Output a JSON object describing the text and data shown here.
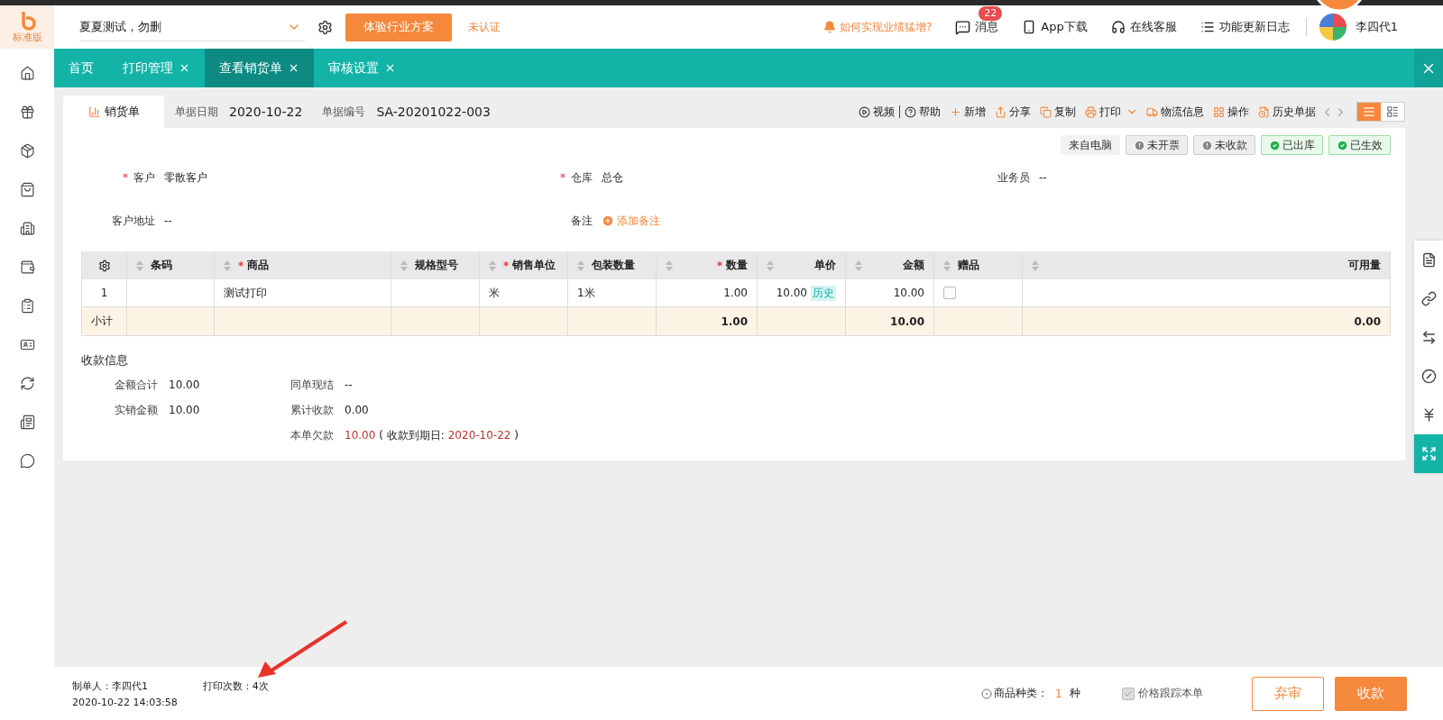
{
  "logo": {
    "label": "标准版"
  },
  "header": {
    "company": "夏夏测试，勿删",
    "trial_button": "体验行业方案",
    "certification": "未认证",
    "promo": "如何实现业绩猛增?",
    "messages": {
      "label": "消息",
      "badge": "22"
    },
    "links": [
      {
        "kind": "phone",
        "label": "App下载"
      },
      {
        "kind": "headset",
        "label": "在线客服"
      },
      {
        "kind": "log",
        "label": "功能更新日志"
      }
    ],
    "user": "李四代1"
  },
  "tabs": [
    {
      "label": "首页",
      "closable": false,
      "selected": false
    },
    {
      "label": "打印管理",
      "closable": true,
      "selected": false
    },
    {
      "label": "查看销货单",
      "closable": true,
      "selected": true
    },
    {
      "label": "审核设置",
      "closable": true,
      "selected": false
    }
  ],
  "document": {
    "tab": "销货单",
    "date_label": "单据日期",
    "date": "2020-10-22",
    "number_label": "单据编号",
    "number": "SA-20201022-003"
  },
  "toolbar": [
    {
      "kind": "video",
      "label": "视频"
    },
    {
      "kind": "help",
      "label": "帮助"
    },
    {
      "kind": "add",
      "label": "新增"
    },
    {
      "kind": "share",
      "label": "分享"
    },
    {
      "kind": "copy",
      "label": "复制"
    },
    {
      "kind": "print",
      "label": "打印"
    },
    {
      "kind": "logistics",
      "label": "物流信息"
    },
    {
      "kind": "operate",
      "label": "操作"
    },
    {
      "kind": "history",
      "label": "历史单据"
    }
  ],
  "view_toggle": [
    {
      "kind": "list",
      "selected": true
    },
    {
      "kind": "card",
      "selected": false
    }
  ],
  "status_tags": [
    {
      "label": "来自电脑",
      "kind": "plain"
    },
    {
      "label": "未开票",
      "kind": "warn"
    },
    {
      "label": "未收款",
      "kind": "warn"
    },
    {
      "label": "已出库",
      "kind": "done"
    },
    {
      "label": "已生效",
      "kind": "done"
    }
  ],
  "fields": [
    {
      "mark": "*",
      "label": "客户",
      "value": "零散客户"
    },
    {
      "mark": "*",
      "label": "仓库",
      "value": "总仓"
    },
    {
      "label": "业务员",
      "value": "--"
    },
    {
      "label": "客户地址",
      "value": "--"
    },
    {
      "label": "备注",
      "action": "添加备注"
    }
  ],
  "table": {
    "columns": [
      {
        "label": "条码",
        "kind": "text"
      },
      {
        "mark": "*",
        "label": "商品",
        "kind": "text"
      },
      {
        "label": "规格型号",
        "kind": "text"
      },
      {
        "mark": "*",
        "label": "销售单位",
        "kind": "text"
      },
      {
        "label": "包装数量",
        "kind": "text"
      },
      {
        "mark": "*",
        "label": "数量",
        "kind": "number"
      },
      {
        "label": "单价",
        "kind": "number"
      },
      {
        "label": "金额",
        "kind": "number"
      },
      {
        "label": "赠品",
        "kind": "check"
      },
      {
        "label": "可用量",
        "kind": "number"
      }
    ],
    "rows": [
      {
        "index": "1",
        "cells": [
          null,
          "测试打印",
          null,
          "米",
          "1米",
          "1.00",
          "10.00",
          "10.00",
          null,
          null
        ],
        "price_tag": "历史",
        "gift": false
      }
    ],
    "subtotal": {
      "label": "小计",
      "cells": [
        null,
        null,
        null,
        null,
        null,
        "1.00",
        null,
        "10.00",
        null,
        "0.00"
      ]
    }
  },
  "payment": {
    "title": "收款信息",
    "left": [
      {
        "label": "金额合计",
        "value": "10.00"
      },
      {
        "label": "实销金额",
        "value": "10.00"
      }
    ],
    "right": [
      {
        "label": "同单现结",
        "value": "--"
      },
      {
        "label": "累计收款",
        "value": "0.00"
      },
      {
        "label": "本单欠款",
        "value": "10.00",
        "due_prefix": "( 收款到期日:",
        "due_date": "2020-10-22",
        "due_suffix": ")"
      }
    ]
  },
  "side_tools": [
    {
      "kind": "note",
      "selected": false
    },
    {
      "kind": "link",
      "selected": false
    },
    {
      "kind": "exchange",
      "selected": false
    },
    {
      "kind": "debt",
      "selected": false
    },
    {
      "kind": "yen",
      "selected": false
    },
    {
      "kind": "expand",
      "selected": true
    }
  ],
  "footer": {
    "creator": "制单人：李四代1",
    "print_count": "打印次数：4次",
    "created": "2020-10-22 14:03:58",
    "sku_label": "商品种类：",
    "sku_count": "1",
    "sku_unit": "种",
    "price_track": {
      "label": "价格跟踪本单",
      "checked": true
    },
    "buttons": [
      {
        "label": "弃审",
        "kind": "secondary"
      },
      {
        "label": "收款",
        "kind": "primary"
      }
    ]
  }
}
